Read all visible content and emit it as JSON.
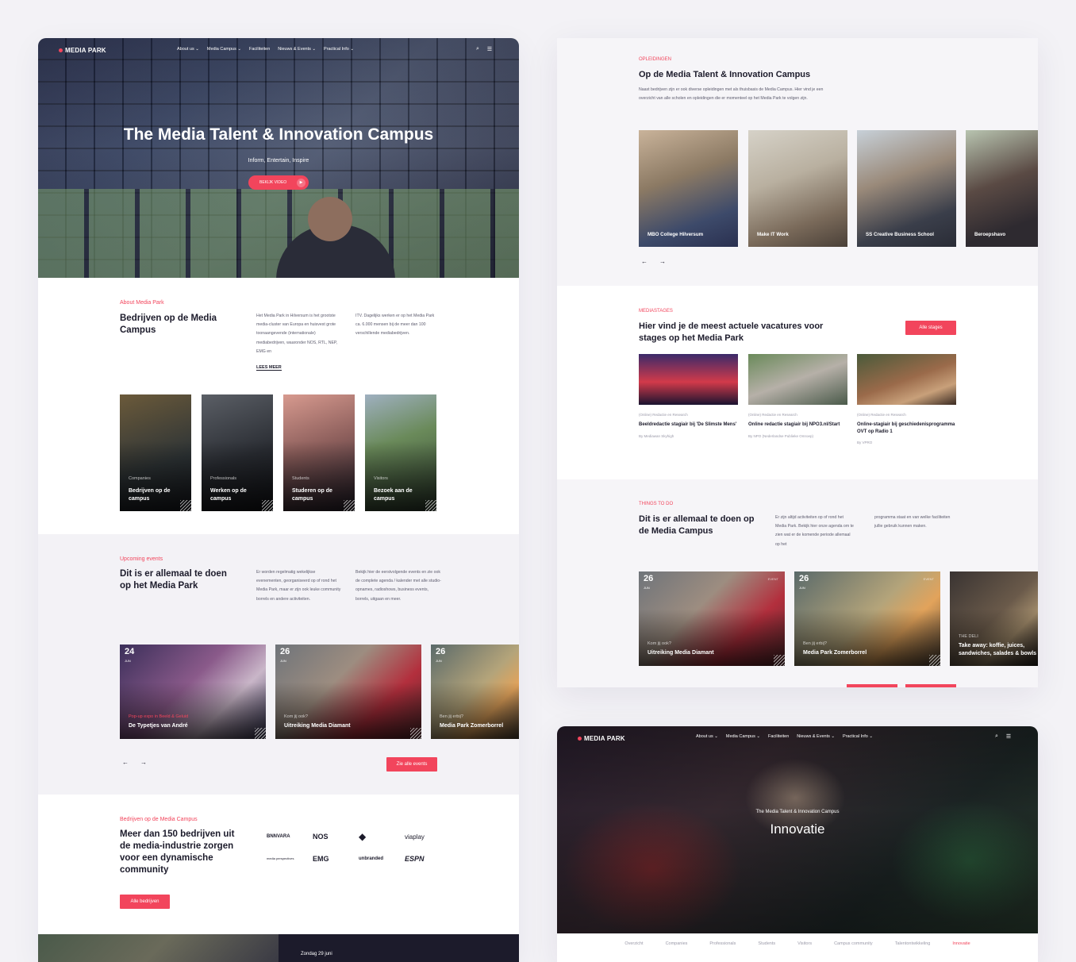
{
  "nav": {
    "logo": "MEDIA PARK",
    "items": [
      "About us ⌄",
      "Media Campus ⌄",
      "Faciliteiten",
      "Nieuws & Events ⌄",
      "Practical Info ⌄"
    ],
    "search_icon": "⌕",
    "menu_icon": "☰"
  },
  "hero": {
    "title": "The Media Talent & Innovation Campus",
    "subtitle": "Inform, Entertain, Inspire",
    "button": "BEKIJK VIDEO",
    "play_icon": "▶"
  },
  "about": {
    "label": "About Media Park",
    "title": "Bedrijven op de Media Campus",
    "text1": "Het Media Park in Hilversum is het grootste media-cluster van Europa en huisvest grote toonaangevende (internationale) mediabedrijven, waaronder NOS, RTL, NEP, EMG en",
    "text2": "ITV. Dagelijks werken er op het Media Park ca. 6.000 mensen bij de meer dan 100 verschillende mediabedrijven.",
    "read_more": "LEES MEER"
  },
  "categories": [
    {
      "cat": "Companies",
      "title": "Bedrijven op de campus"
    },
    {
      "cat": "Professionals",
      "title": "Werken op de campus"
    },
    {
      "cat": "Students",
      "title": "Studeren op de campus"
    },
    {
      "cat": "Visitors",
      "title": "Bezoek aan de campus"
    }
  ],
  "events": {
    "label": "Upcoming events",
    "title": "Dit is er allemaal te doen op het Media Park",
    "text1": "Er worden regelmatig wekelijkse evenementen, georganiseerd op of rond het Media Park, maar er zijn ook leuke community borrels en andere activiteiten.",
    "text2": "Bekijk hier de eerstvolgende events en zie ook de complete agenda / kalender met alle studio-opnames, radioshows, business events, borrels, uitgaan en meer.",
    "items": [
      {
        "day": "24",
        "month": "JUN",
        "tag": "Pop-up expo in Beeld & Geluid",
        "title": "De Typetjes van André"
      },
      {
        "day": "26",
        "month": "JUN",
        "tag": "Kom jij ook?",
        "title": "Uitreiking Media Diamant"
      },
      {
        "day": "26",
        "month": "JUN",
        "tag": "Ben jij erbij?",
        "title": "Media Park Zomerborrel"
      }
    ],
    "prev_icon": "←",
    "next_icon": "→",
    "all_button": "Zie alle events"
  },
  "companies": {
    "label": "Bedrijven op de Media Campus",
    "title": "Meer dan 150 bedrijven uit de media-industrie zorgen voor een dynamische community",
    "logos": [
      "BNNVARA",
      "NOS",
      "◆",
      "viaplay",
      "media perspectives",
      "EMG",
      "unbranded",
      "ESPN"
    ],
    "button": "Alle bedrijven"
  },
  "footer_teaser": {
    "date": "Zondag 29 juni"
  },
  "education": {
    "label": "OPLEIDINGEN",
    "title": "Op de Media Talent & Innovation Campus",
    "text": "Naast bedrijven zijn er ook diverse opleidingen met als thuisbasis de Media Campus. Hier vind je een overzicht van alle scholen en opleidingen die er momenteel op het Media Park te volgen zijn.",
    "schools": [
      "MBO College Hilversum",
      "Make IT Work",
      "SS Creative Business School",
      "Beroepshavo"
    ],
    "prev_icon": "←",
    "next_icon": "→"
  },
  "internships": {
    "label": "MEDIASTAGES",
    "title": "Hier vind je de meest actuele vacatures voor stages op het Media Park",
    "button": "Alle stages",
    "items": [
      {
        "tag": "(Online) Redactie en Research",
        "title": "Beeldredactie stagiair bij 'De Slimste Mens'",
        "by": "By Mediawan Skyhigh"
      },
      {
        "tag": "(Online) Redactie en Research",
        "title": "Online redactie stagiair bij NPO3.nl/Start",
        "by": "By NPO (Nederlandse Publieke Omroep)"
      },
      {
        "tag": "(Online) Redactie en Research",
        "title": "Online-stagiair bij geschiedenisprogramma OVT op Radio 1",
        "by": "By VPRO"
      }
    ]
  },
  "todo": {
    "label": "THINGS TO DO",
    "title": "Dit is er allemaal te doen op de Media Campus",
    "text1": "Er zijn altijd activiteiten op of rond het Media Park. Bekijk hier onze agenda om te zien wat er de komende periode allemaal op het",
    "text2": "programma staat en van welke faciliteiten jullie gebruik kunnen maken.",
    "items": [
      {
        "day": "26",
        "month": "JUN",
        "badge": "EVENT",
        "tag": "Kom jij ook?",
        "title": "Uitreiking Media Diamant"
      },
      {
        "day": "26",
        "month": "JUN",
        "badge": "EVENT",
        "tag": "Ben jij erbij?",
        "title": "Media Park Zomerborrel"
      },
      {
        "day": "",
        "month": "",
        "badge": "",
        "tag": "THE DELI",
        "title": "Take away: koffie, juices, sandwiches, salades & bowls"
      }
    ]
  },
  "innovation": {
    "kicker": "The Media Talent & Innovation Campus",
    "title": "Innovatie",
    "subnav": [
      "Overzicht",
      "Companies",
      "Professionals",
      "Students",
      "Visitors",
      "Campus community",
      "Talentontwikkeling",
      "Innovatie"
    ]
  },
  "colors": {
    "accent": "#f2455c",
    "dark": "#1c1b2b",
    "background": "#f3f2f6"
  }
}
